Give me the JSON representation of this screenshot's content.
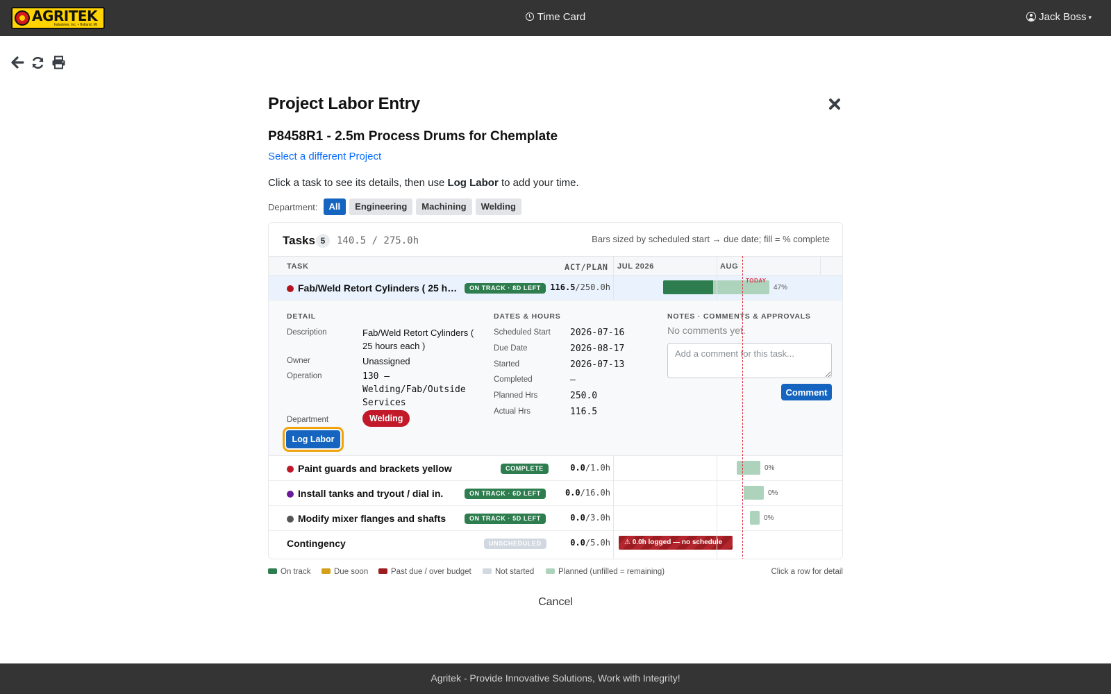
{
  "header": {
    "logo_text": "AGRITEK",
    "logo_subtext": "Industries, Inc. • Holland, MI",
    "app_title": "Time Card",
    "user_name": "Jack Boss"
  },
  "page": {
    "title": "Project Labor Entry",
    "project_title": "P8458R1 - 2.5m Process Drums for Chemplate",
    "change_project_link": "Select a different Project",
    "instructions_pre": "Click a task to see its details, then use ",
    "instructions_bold": "Log Labor",
    "instructions_post": " to add your time.",
    "cancel_label": "Cancel"
  },
  "departments": {
    "label": "Department:",
    "options": [
      "All",
      "Engineering",
      "Machining",
      "Welding"
    ],
    "selected": "All"
  },
  "tasks_panel": {
    "title": "Tasks",
    "count": "5",
    "hours_summary": "140.5 / 275.0h",
    "bars_note": "Bars sized by scheduled start → due date; fill = % complete",
    "columns": {
      "task": "TASK",
      "act_plan": "ACT/PLAN",
      "month1": "JUL 2026",
      "month2": "AUG"
    },
    "today_label": "TODAY"
  },
  "tasks": [
    {
      "name": "Fab/Weld Retort Cylinders ( 25 hou...",
      "dot_color": "#b3141f",
      "status": "ON TRACK · 8D LEFT",
      "actual": "116.5",
      "planned": "/250.0h",
      "pct_label": "47%",
      "pct": 0.47,
      "selected": true
    },
    {
      "name": "Paint guards and brackets yellow",
      "dot_color": "#c0172a",
      "status": "COMPLETE",
      "actual": "0.0",
      "planned": "/1.0h",
      "pct_label": "0%",
      "pct": 0
    },
    {
      "name": "Install tanks and tryout / dial in.",
      "dot_color": "#6a1b9a",
      "status": "ON TRACK · 6D LEFT",
      "actual": "0.0",
      "planned": "/16.0h",
      "pct_label": "0%",
      "pct": 0
    },
    {
      "name": "Modify mixer flanges and shafts",
      "dot_color": "#555555",
      "status": "ON TRACK · 5D LEFT",
      "actual": "0.0",
      "planned": "/3.0h",
      "pct_label": "0%",
      "pct": 0
    },
    {
      "name": "Contingency",
      "status": "UNSCHEDULED",
      "actual": "0.0",
      "planned": "/5.0h",
      "warning": "⚠ 0.0h logged — no schedule"
    }
  ],
  "detail": {
    "section_detail": "DETAIL",
    "section_dates": "DATES & HOURS",
    "section_notes": "NOTES · COMMENTS & APPROVALS",
    "description_label": "Description",
    "description_value": "Fab/Weld Retort Cylinders ( 25 hours each )",
    "owner_label": "Owner",
    "owner_value": "Unassigned",
    "operation_label": "Operation",
    "operation_value": "130 – Welding/Fab/Outside Services",
    "department_label": "Department",
    "department_value": "Welding",
    "log_labor_label": "Log Labor",
    "scheduled_start_label": "Scheduled Start",
    "scheduled_start_value": "2026-07-16",
    "due_date_label": "Due Date",
    "due_date_value": "2026-08-17",
    "started_label": "Started",
    "started_value": "2026-07-13",
    "completed_label": "Completed",
    "completed_value": "—",
    "planned_hrs_label": "Planned Hrs",
    "planned_hrs_value": "250.0",
    "actual_hrs_label": "Actual Hrs",
    "actual_hrs_value": "116.5",
    "no_comments": "No comments yet.",
    "comment_placeholder": "Add a comment for this task...",
    "comment_button": "Comment"
  },
  "legend": {
    "items": [
      {
        "label": "On track",
        "color": "#2e7d4f"
      },
      {
        "label": "Due soon",
        "color": "#d4a017"
      },
      {
        "label": "Past due / over budget",
        "color": "#9c1c22"
      },
      {
        "label": "Not started",
        "color": "#d2d8e0"
      },
      {
        "label": "Planned (unfilled = remaining)",
        "color": "#aed3bd"
      }
    ],
    "hint": "Click a row for detail"
  },
  "footer": {
    "text": "Agritek - Provide Innovative Solutions, Work with Integrity!"
  }
}
